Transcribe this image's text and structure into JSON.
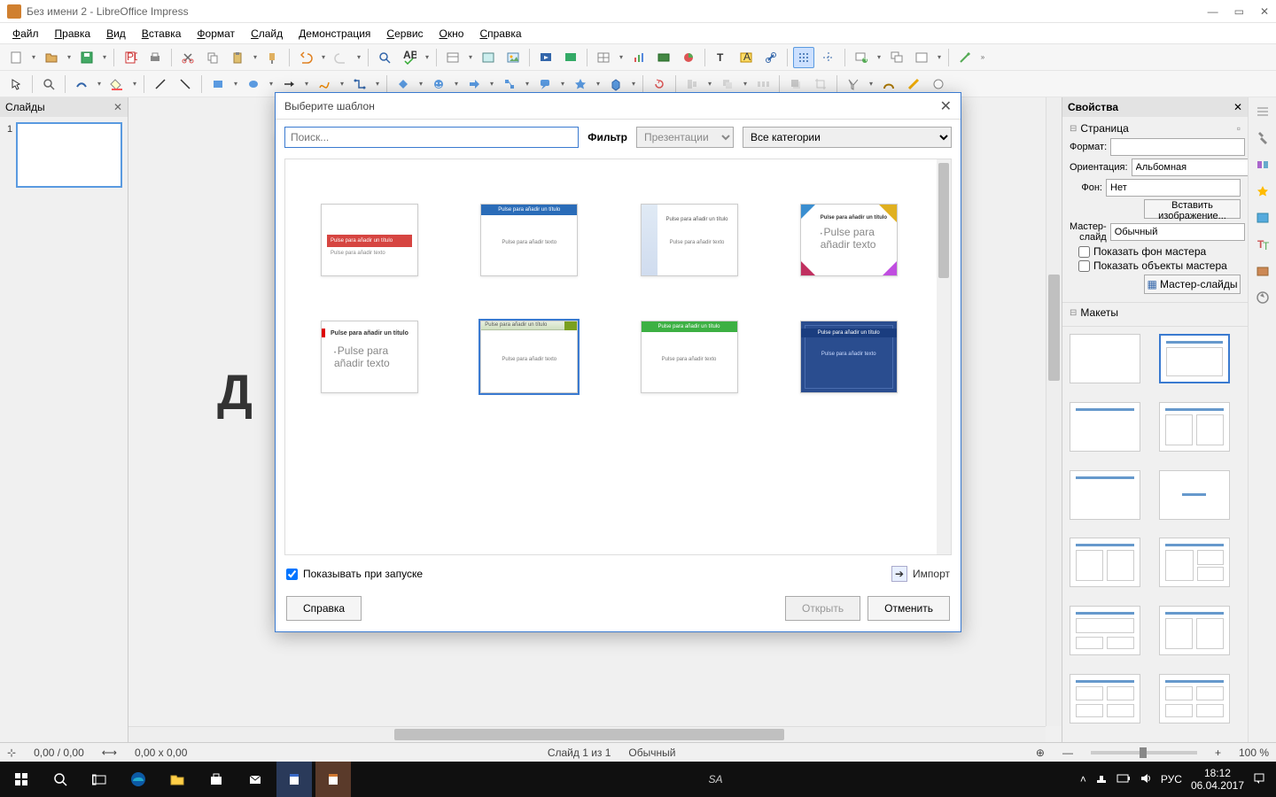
{
  "window": {
    "title": "Без имени 2 - LibreOffice Impress"
  },
  "menu": [
    "Файл",
    "Правка",
    "Вид",
    "Вставка",
    "Формат",
    "Слайд",
    "Демонстрация",
    "Сервис",
    "Окно",
    "Справка"
  ],
  "slide_panel": {
    "title": "Слайды",
    "slide_number": "1"
  },
  "canvas_char": "Д",
  "sidebar": {
    "title": "Свойства",
    "page_section": "Страница",
    "format_label": "Формат:",
    "format_value": "",
    "orientation_label": "Ориентация:",
    "orientation_value": "Альбомная",
    "background_label": "Фон:",
    "background_value": "Нет",
    "insert_image_btn": "Вставить изображение...",
    "master_label": "Мастер-слайд",
    "master_value": "Обычный",
    "show_bg_chk": "Показать фон мастера",
    "show_obj_chk": "Показать объекты мастера",
    "master_btn": "Мастер-слайды",
    "layouts_section": "Макеты"
  },
  "statusbar": {
    "coords": "0,00 / 0,00",
    "size": "0,00 x 0,00",
    "slide_info": "Слайд 1 из 1",
    "mode": "Обычный",
    "zoom": "100 %"
  },
  "dialog": {
    "title": "Выберите шаблон",
    "search_placeholder": "Поиск...",
    "filter_label": "Фильтр",
    "filter_type": "Презентации",
    "filter_cat": "Все категории",
    "startup_chk": "Показывать при запуске",
    "import_label": "Импорт",
    "help_btn": "Справка",
    "open_btn": "Открыть",
    "cancel_btn": "Отменить",
    "sample_title": "Pulse para añadir un título",
    "sample_text": "Pulse para añadir texto"
  },
  "taskbar": {
    "lang": "РУС",
    "time": "18:12",
    "date": "06.04.2017",
    "search_prompt": "SA"
  }
}
